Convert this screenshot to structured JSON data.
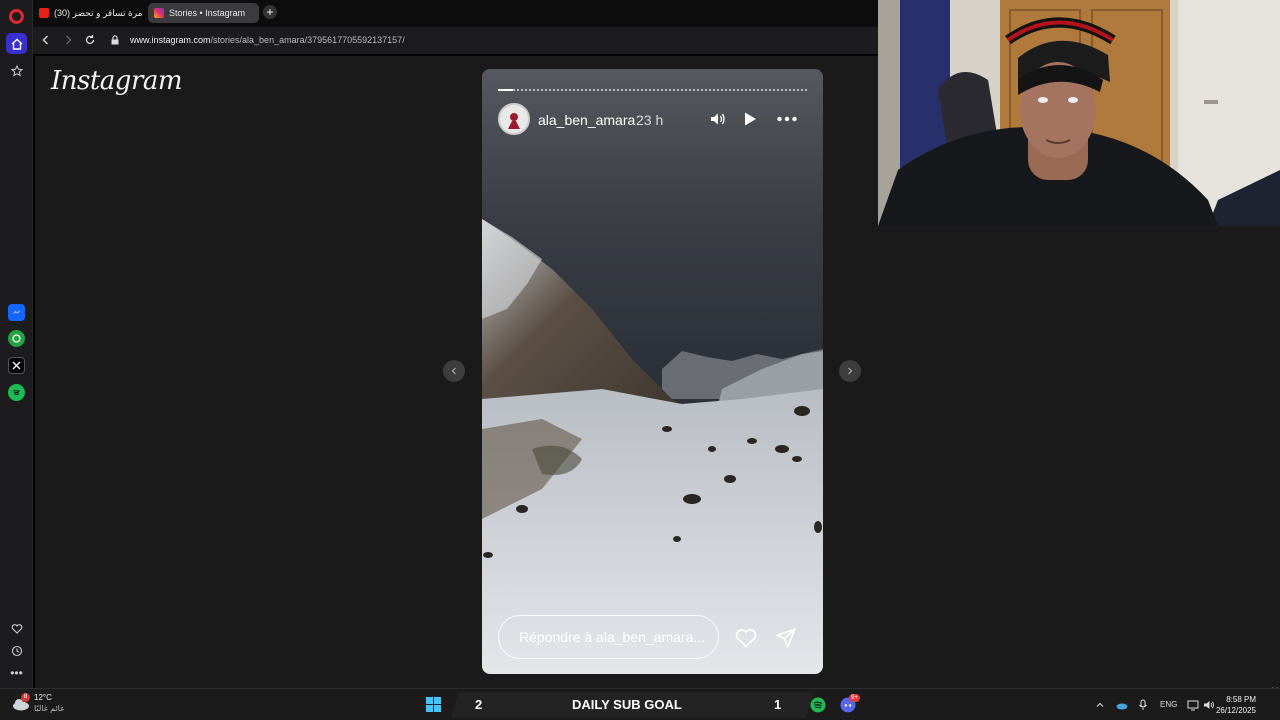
{
  "browser": {
    "tabs": [
      {
        "label": "(30) أول مرة تسافر و تحضر",
        "active": false
      },
      {
        "label": "Stories • Instagram",
        "active": true
      }
    ],
    "url_host": "www.instagram.com",
    "url_path": "/stories/ala_ben_amara/3795617705592137157/"
  },
  "page": {
    "logo_text": "Instagram"
  },
  "story": {
    "username": "ala_ben_amara",
    "time_ago": "23 h",
    "reply_placeholder": "Répondre à ala_ben_amara...",
    "progress_fraction": 0.05
  },
  "taskbar": {
    "weather_temp": "12°C",
    "weather_desc": "غائم غالبًا",
    "weather_badge": "8",
    "goal_left": "2",
    "goal_label": "DAILY SUB GOAL",
    "goal_right": "1",
    "language": "ENG",
    "time": "8:58 PM",
    "date": "26/12/2025",
    "discord_badge": "9+"
  },
  "colors": {
    "opera_red": "#e0262f",
    "sidebar_active": "#3a2fd1",
    "page_bg": "#1a1a1a"
  }
}
